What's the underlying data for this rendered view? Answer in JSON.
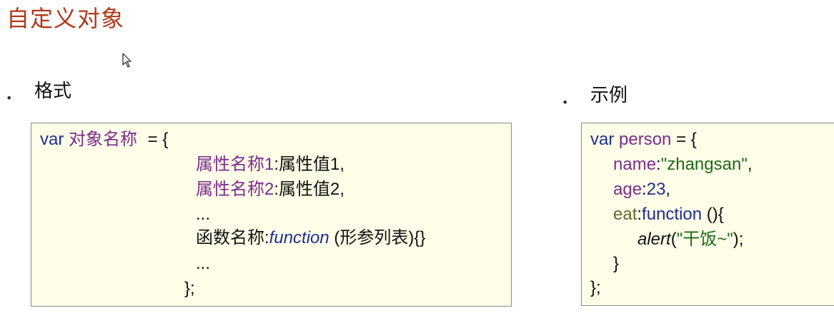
{
  "slide": {
    "title": "自定义对象"
  },
  "bullets": {
    "dot": "•",
    "format_label": "格式",
    "example_label": "示例"
  },
  "format_code": {
    "l1_kw": "var",
    "l1_name": "对象名称",
    "l1_rest": " = {",
    "l2_prop": "属性名称1",
    "l2_rest": ":属性值1,",
    "l3_prop": "属性名称2",
    "l3_rest": ":属性值2,",
    "l4": "...",
    "l5_name": "函数名称:",
    "l5_fn": "function",
    "l5_rest": " (形参列表){}",
    "l6": "...",
    "l7": "};"
  },
  "example_code": {
    "l1_kw": "var",
    "l1_name": "person",
    "l1_rest": " = {",
    "l2_prop": "name",
    "l2_colon": ":",
    "l2_val": "\"zhangsan\"",
    "l2_comma": ",",
    "l3_prop": "age",
    "l3_colon": ":",
    "l3_val": "23",
    "l3_comma": ",",
    "l4_prop": "eat",
    "l4_colon": ":",
    "l4_fn": "function",
    "l4_rest": " (){",
    "l5_call": "alert",
    "l5_open": "(",
    "l5_str": "\"干饭~\"",
    "l5_close": ");",
    "l6": "}",
    "l7": "};"
  },
  "colors": {
    "title": "#b03a1c",
    "keyword": "#1e2f8f",
    "property": "#7a2c8f",
    "string": "#1b6a1b",
    "box_bg": "#fffee8"
  }
}
